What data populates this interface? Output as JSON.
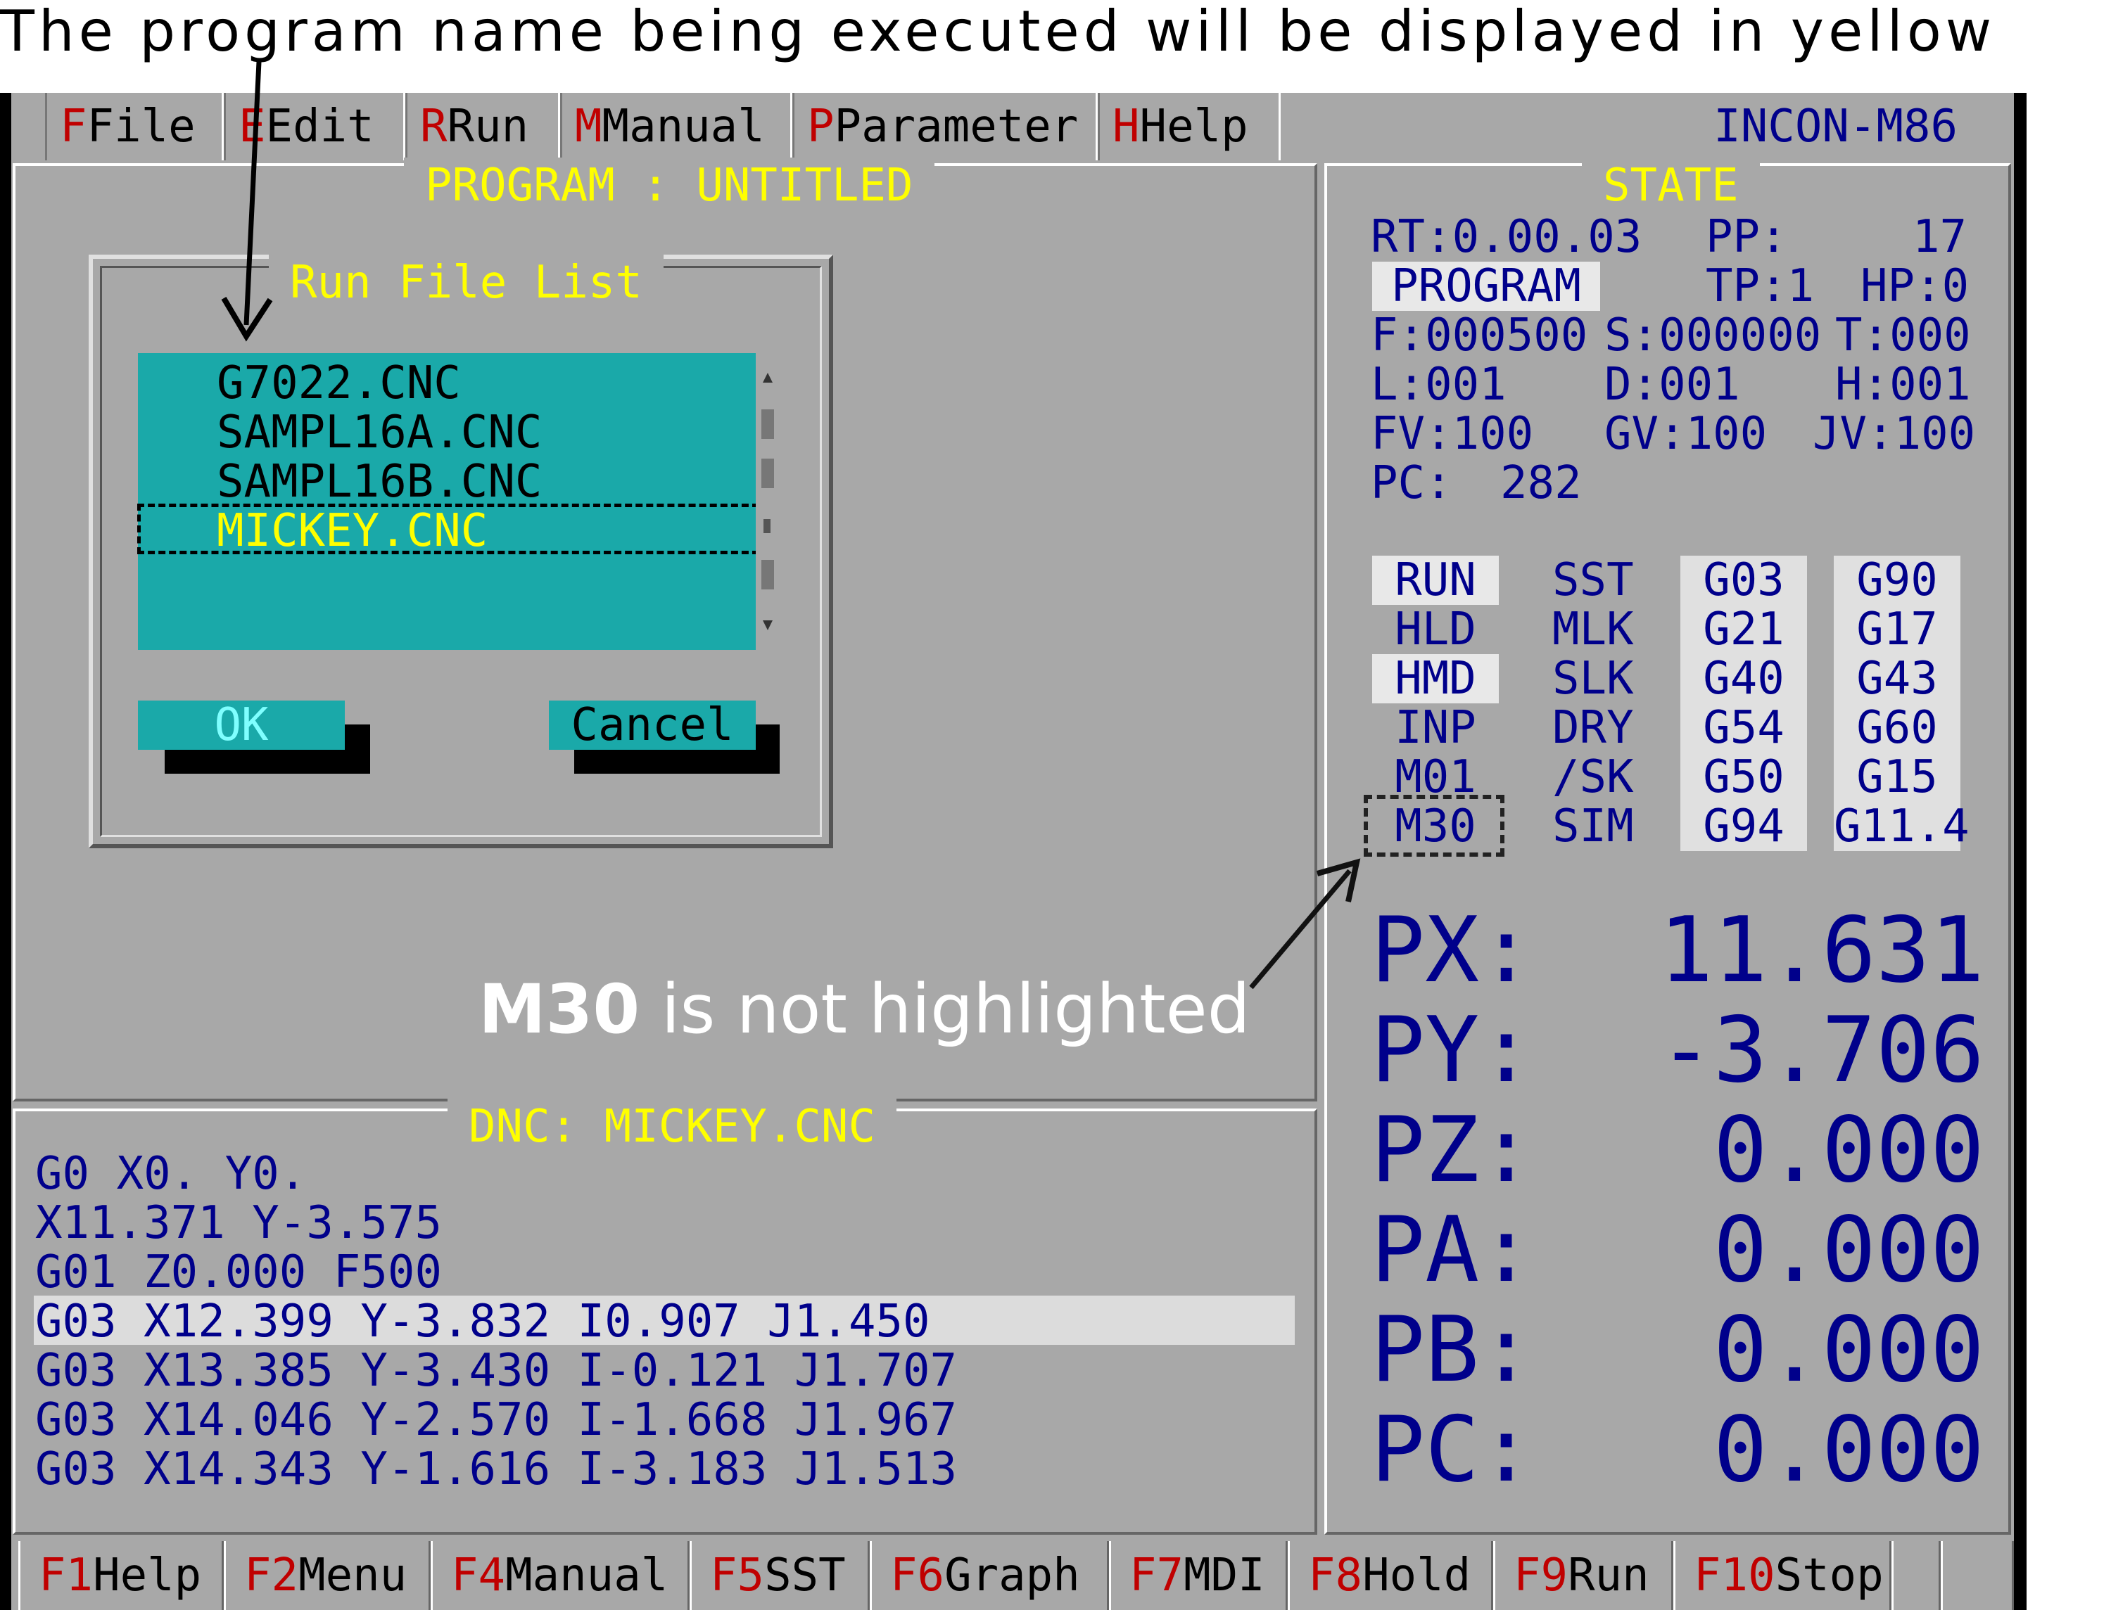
{
  "annotations": {
    "top_caption": "The program name being executed will be displayed in yellow",
    "m30_bold": "M30",
    "m30_rest": " is not highlighted"
  },
  "menu": {
    "items": [
      {
        "hot": "F",
        "label": "File"
      },
      {
        "hot": "E",
        "label": "Edit"
      },
      {
        "hot": "R",
        "label": "Run"
      },
      {
        "hot": "M",
        "label": "Manual"
      },
      {
        "hot": "P",
        "label": "Parameter"
      },
      {
        "hot": "H",
        "label": "Help"
      }
    ],
    "brand": "INCON-M86"
  },
  "program_panel": {
    "title": "PROGRAM : UNTITLED"
  },
  "dialog": {
    "title": "Run File List",
    "files": [
      "G7022.CNC",
      "SAMPL16A.CNC",
      "SAMPL16B.CNC",
      "MICKEY.CNC"
    ],
    "selected_index": 3,
    "ok_label": "OK",
    "cancel_label": "Cancel"
  },
  "dnc": {
    "title": "DNC: MICKEY.CNC",
    "lines": [
      "G0 X0. Y0.",
      "X11.371 Y-3.575",
      "G01 Z0.000 F500",
      "G03 X12.399 Y-3.832 I0.907 J1.450",
      "G03 X13.385 Y-3.430 I-0.121 J1.707",
      "G03 X14.046 Y-2.570 I-1.668 J1.967",
      "G03 X14.343 Y-1.616 I-3.183 J1.513"
    ],
    "current_line_index": 3
  },
  "state": {
    "title": "STATE",
    "rt": "RT:0.00.03",
    "pp_label": "PP:",
    "pp_value": "17",
    "mode": "PROGRAM",
    "tp": "TP:1",
    "hp": "HP:0",
    "f": "F:000500",
    "s": "S:000000",
    "t": "T:000",
    "l": "L:001",
    "d": "D:001",
    "h": "H:001",
    "fv": "FV:100",
    "gv": "GV:100",
    "jv": "JV:100",
    "pc_label": "PC:",
    "pc_value": "282",
    "status_col1": [
      "RUN",
      "HLD",
      "HMD",
      "INP",
      "M01",
      "M30"
    ],
    "status_col2": [
      "SST",
      "MLK",
      "SLK",
      "DRY",
      "/SK",
      "SIM"
    ],
    "gcode_col1": [
      "G03",
      "G21",
      "G40",
      "G54",
      "G50",
      "G94"
    ],
    "gcode_col2": [
      "G90",
      "G17",
      "G43",
      "G60",
      "G15",
      "G11.4"
    ],
    "coords": [
      {
        "label": "PX:",
        "value": "11.631"
      },
      {
        "label": "PY:",
        "value": "-3.706"
      },
      {
        "label": "PZ:",
        "value": "0.000"
      },
      {
        "label": "PA:",
        "value": "0.000"
      },
      {
        "label": "PB:",
        "value": "0.000"
      },
      {
        "label": "PC:",
        "value": "0.000"
      }
    ]
  },
  "function_keys": [
    {
      "hot": "F1",
      "label": "Help"
    },
    {
      "hot": "F2",
      "label": "Menu"
    },
    {
      "hot": "F4",
      "label": "Manual"
    },
    {
      "hot": "F5",
      "label": "SST"
    },
    {
      "hot": "F6",
      "label": "Graph"
    },
    {
      "hot": "F7",
      "label": "MDI"
    },
    {
      "hot": "F8",
      "label": "Hold"
    },
    {
      "hot": "F9",
      "label": "Run"
    },
    {
      "hot": "F10",
      "label": "Stop"
    }
  ]
}
